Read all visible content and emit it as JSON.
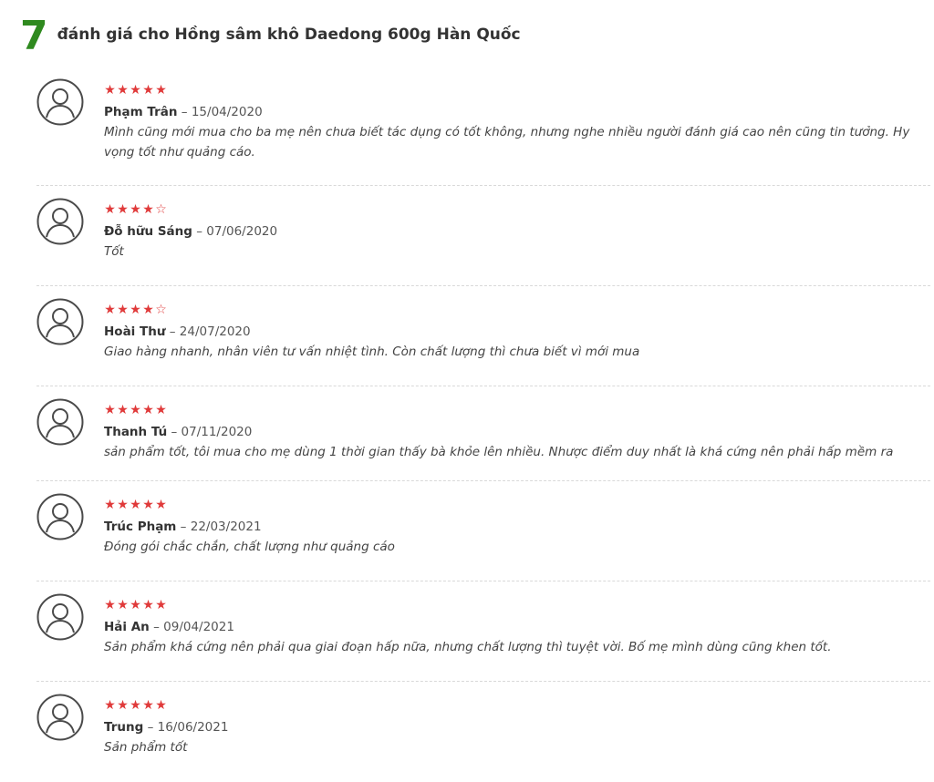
{
  "header": {
    "count": "7",
    "title": "đánh giá cho Hồng sâm khô Daedong 600g Hàn Quốc"
  },
  "colors": {
    "count": "#2f8a1f",
    "star": "#e03a3a"
  },
  "reviews": [
    {
      "rating": 5,
      "author": "Phạm Trân",
      "sep": " – ",
      "date": "15/04/2020",
      "text": "Mình cũng mới mua cho ba mẹ nên chưa biết tác dụng có tốt không, nhưng nghe nhiều người đánh giá cao nên cũng tin tưởng. Hy vọng tốt như quảng cáo."
    },
    {
      "rating": 4,
      "author": "Đỗ hữu Sáng",
      "sep": " – ",
      "date": "07/06/2020",
      "text": "Tốt"
    },
    {
      "rating": 4,
      "author": "Hoài Thư",
      "sep": " – ",
      "date": "24/07/2020",
      "text": "Giao hàng nhanh, nhân viên tư vấn nhiệt tình. Còn chất lượng thì chưa biết vì mới mua"
    },
    {
      "rating": 5,
      "author": "Thanh Tú",
      "sep": " – ",
      "date": "07/11/2020",
      "text": "sản phẩm tốt, tôi mua cho mẹ dùng 1 thời gian thấy bà khỏe lên nhiều. Nhược điểm duy nhất là khá cứng nên phải hấp mềm ra"
    },
    {
      "rating": 5,
      "author": "Trúc Phạm",
      "sep": " – ",
      "date": "22/03/2021",
      "text": "Đóng gói chắc chắn, chất lượng như quảng cáo"
    },
    {
      "rating": 5,
      "author": "Hải An",
      "sep": " – ",
      "date": "09/04/2021",
      "text": "Sản phẩm khá cứng nên phải qua giai đoạn hấp nữa, nhưng chất lượng thì tuyệt vời. Bố mẹ mình dùng cũng khen tốt."
    },
    {
      "rating": 5,
      "author": "Trung",
      "sep": " – ",
      "date": "16/06/2021",
      "text": "Sản phẩm tốt"
    }
  ]
}
